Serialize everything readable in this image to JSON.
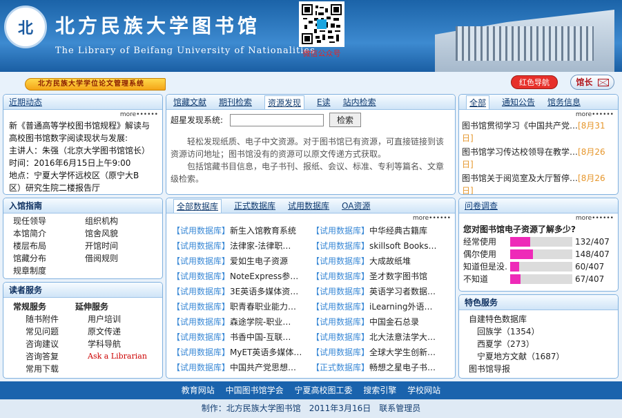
{
  "header": {
    "logo_text": "北",
    "title_cn": "北方民族大学图书馆",
    "title_en": "The Library of Beifang University of Nationalities",
    "qr_caption": "微信公众号"
  },
  "subbar": {
    "banner": "北方民族大学学位论文管理系统",
    "red_button": "红色导航",
    "mail_button": "馆长"
  },
  "news": {
    "title": "近期动态",
    "more": "more••••••",
    "lines": [
      "新《普通高等学校图书馆规程》解读与",
      "高校图书馆数字阅读现状与发展:",
      "主讲人：朱强（北京大学图书馆馆长）",
      "时间：2016年6月15日上午9:00",
      "地点：宁夏大学怀远校区（原宁大B",
      "区）研究生院二楼报告厅"
    ]
  },
  "search": {
    "tabs": [
      "馆藏文献",
      "期刊检索",
      "资源发现",
      "E读",
      "站内检索"
    ],
    "label": "超星发现系统:",
    "button": "检索",
    "desc1": "轻松发现纸质、电子中文资源。对于图书馆已有资源，可直接链接到该资源访问地址；图书馆没有的资源可以原文传递方式获取。",
    "desc2": "包括馆藏书目信息，电子书刊、报纸、会议、标准、专利等篇名、文章级检索。"
  },
  "notices": {
    "tabs": [
      "全部",
      "通知公告",
      "馆务信息"
    ],
    "more": "more••••••",
    "items": [
      {
        "text": "图书馆贯彻学习《中国共产党…",
        "date": "[8月31日]"
      },
      {
        "text": "图书馆学习传达校领导在教学…",
        "date": "[8月26日]"
      },
      {
        "text": "图书馆关于阅览室及大厅暂停…",
        "date": "[8月26日]"
      }
    ]
  },
  "guide": {
    "title": "入馆指南",
    "col1": [
      "现任领导",
      "本馆简介",
      "楼层布局",
      "馆藏分布",
      "规章制度"
    ],
    "col2": [
      "组织机构",
      "馆舍风貌",
      "开馆时间",
      "借阅规则"
    ]
  },
  "reader": {
    "title": "读者服务",
    "col1_title": "常规服务",
    "col2_title": "延伸服务",
    "col1": [
      "随书附件",
      "常见问题",
      "咨询建议",
      "咨询答复",
      "常用下载"
    ],
    "col2": [
      "用户培训",
      "原文传递",
      "学科导航",
      "Ask a Librarian"
    ]
  },
  "databases": {
    "tabs": [
      "全部数据库",
      "正式数据库",
      "试用数据库",
      "OA资源"
    ],
    "more": "more••••••",
    "left": [
      {
        "tag": "【试用数据库】",
        "name": "新生入馆教育系统"
      },
      {
        "tag": "【试用数据库】",
        "name": "法律家-法律职…"
      },
      {
        "tag": "【试用数据库】",
        "name": "爱如生电子资源"
      },
      {
        "tag": "【试用数据库】",
        "name": "NoteExpress参…"
      },
      {
        "tag": "【试用数据库】",
        "name": "3E英语多媒体资…"
      },
      {
        "tag": "【试用数据库】",
        "name": "职青春职业能力…"
      },
      {
        "tag": "【试用数据库】",
        "name": "森途学院-职业…"
      },
      {
        "tag": "【试用数据库】",
        "name": "书香中国-互联…"
      },
      {
        "tag": "【试用数据库】",
        "name": "MyET英语多媒体…"
      },
      {
        "tag": "【试用数据库】",
        "name": "中国共产党思想…"
      }
    ],
    "right": [
      {
        "tag": "【试用数据库】",
        "name": "中华经典古籍库"
      },
      {
        "tag": "【试用数据库】",
        "name": "skillsoft Books…"
      },
      {
        "tag": "【试用数据库】",
        "name": "大成故纸堆"
      },
      {
        "tag": "【试用数据库】",
        "name": "圣才数字图书馆"
      },
      {
        "tag": "【试用数据库】",
        "name": "英语学习者数据…"
      },
      {
        "tag": "【试用数据库】",
        "name": "iLearning外语…"
      },
      {
        "tag": "【试用数据库】",
        "name": "中国金石总录"
      },
      {
        "tag": "【试用数据库】",
        "name": "北大法意法学大…"
      },
      {
        "tag": "【试用数据库】",
        "name": "全球大学生创新…"
      },
      {
        "tag": "【正式数据库】",
        "name": "畅想之星电子书…"
      }
    ]
  },
  "survey": {
    "title": "问卷调查",
    "more": "more••••••",
    "question": "您对图书馆电子资源了解多少?",
    "options": [
      {
        "label": "经常使用",
        "count": "132/407",
        "value": 132
      },
      {
        "label": "偶尔使用",
        "count": "148/407",
        "value": 148
      },
      {
        "label": "知道但是没…",
        "count": "60/407",
        "value": 60
      },
      {
        "label": "不知道",
        "count": "67/407",
        "value": 67
      }
    ],
    "total": 407
  },
  "special": {
    "title": "特色服务",
    "header": "自建特色数据库",
    "items": [
      "回族学（1354）",
      "西夏学（273）",
      "宁夏地方文献（1687）"
    ],
    "footer": "图书馆导报"
  },
  "footer": {
    "links": [
      "教育网站",
      "中国图书馆学会",
      "宁夏高校图工委",
      "搜索引擎",
      "学校网站"
    ],
    "copyright": "制作：北方民族大学图书馆　2011年3月16日　联系管理员"
  },
  "colors": {
    "accent": "#1a63ad",
    "tag_blue": "#3a89d6",
    "date_orange": "#e6962b",
    "bar_pink": "#ee2ab8"
  }
}
